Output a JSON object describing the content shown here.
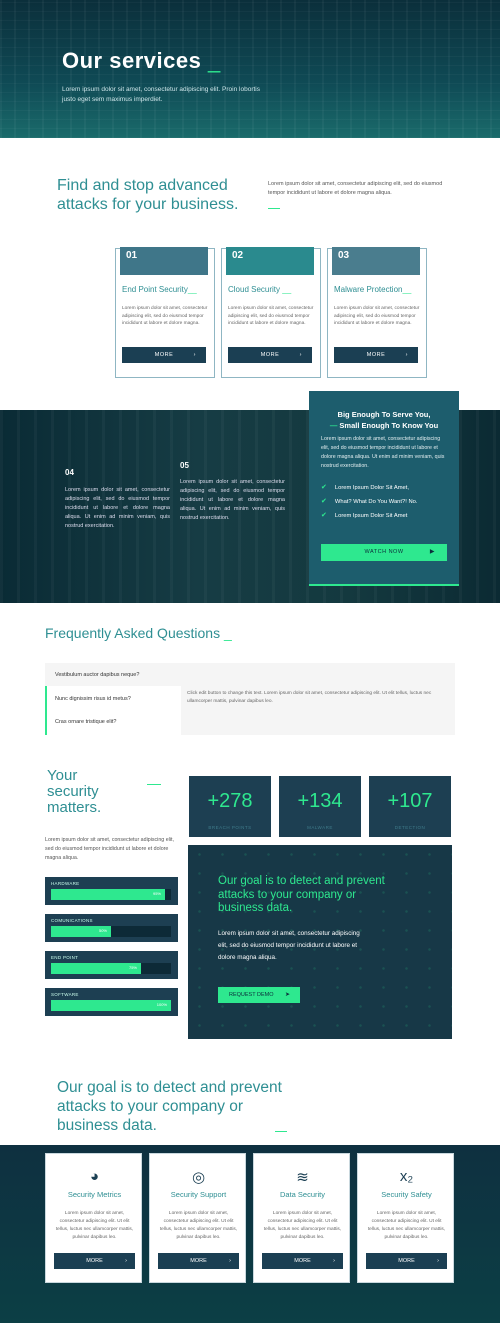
{
  "hero": {
    "title": "Our services",
    "title_underscore": "_",
    "subtitle": "Lorem ipsum dolor sit amet, consectetur adipiscing elit. Proin lobortis justo eget sem maximus imperdiet."
  },
  "intro": {
    "title": "Find and stop advanced attacks for your business.",
    "text": "Lorem ipsum dolor sit amet, consectetur adipiscing elit, sed do eiusmod tempor incididunt ut labore et dolore magna aliqua."
  },
  "services": [
    {
      "num": "01",
      "title": "End Point Security",
      "text": "Lorem ipsum dolor sit amet, consectetur adipiscing elit, sed do eiusmod tempor incididunt ut labore et dolore magna.",
      "button": "MORE"
    },
    {
      "num": "02",
      "title": "Cloud Security",
      "text": "Lorem ipsum dolor sit amet, consectetur adipiscing elit, sed do eiusmod tempor incididunt ut labore et dolore magna.",
      "button": "MORE"
    },
    {
      "num": "03",
      "title": "Malware Protection",
      "text": "Lorem ipsum dolor sit amet, consectetur adipiscing elit, sed do eiusmod tempor incididunt ut labore et dolore magna.",
      "button": "MORE"
    }
  ],
  "band": {
    "features": [
      {
        "num": "04",
        "text": "Lorem ipsum dolor sit amet, consectetur adipiscing elit, sed do eiusmod tempor incididunt ut labore et dolore magna aliqua. Ut enim ad minim veniam, quis nostrud exercitation."
      },
      {
        "num": "05",
        "text": "Lorem ipsum dolor sit amet, consectetur adipiscing elit, sed do eiusmod tempor incididunt ut labore et dolore magna aliqua. Ut enim ad minim veniam, quis nostrud exercitation."
      }
    ],
    "card": {
      "title_line1": "Big Enough To Serve You,",
      "title_line2": "Small Enough To Know You",
      "text": "Lorem ipsum dolor sit amet, consectetur adipiscing elit, sed do eiusmod tempor incididunt ut labore et dolore magna aliqua. Ut enim ad minim veniam, quis nostrud exercitation.",
      "checks": [
        "Lorem Ipsum Dolor Sit Amet,",
        "What? What Do You Want?! No.",
        "Lorem Ipsum Dolor Sit Amet"
      ],
      "button": "WATCH NOW"
    }
  },
  "faq": {
    "title": "Frequently Asked Questions",
    "questions": [
      "Vestibulum auctor dapibus neque?",
      "Nunc dignissim risus id metus?",
      "Cras ornare tristique elit?"
    ],
    "answer": "Click edit button to change this text. Lorem ipsum dolor sit amet, consectetur adipiscing elit. Ut elit tellus, luctus nec ullamcorper mattis, pulvinar dapibus leo."
  },
  "security": {
    "title_line1": "Your",
    "title_line2": "security",
    "title_line3": "matters.",
    "text": "Lorem ipsum dolor sit amet, consectetur adipiscing elit, sed do eiusmod tempor incididunt ut labore et dolore magna aliqua.",
    "bars": [
      {
        "label": "HARDWARE",
        "pct": "95%",
        "value": 0.95
      },
      {
        "label": "COMUNICATIONS",
        "pct": "50%",
        "value": 0.5
      },
      {
        "label": "END POINT",
        "pct": "75%",
        "value": 0.75
      },
      {
        "label": "SOFTWARE",
        "pct": "100%",
        "value": 1.0
      }
    ],
    "stats": [
      {
        "value": "+278",
        "caption": "BREACH POINTS"
      },
      {
        "value": "+134",
        "caption": "MALWARE"
      },
      {
        "value": "+107",
        "caption": "DETECTION"
      }
    ],
    "goal": {
      "title": "Our goal is to detect and prevent attacks to your company or business data.",
      "text": "Lorem ipsum dolor sit amet, consectetur adipiscing elit, sed do eiusmod tempor incididunt ut labore et dolore magna aliqua.",
      "button": "REQUEST DEMO"
    }
  },
  "bottom": {
    "title": "Our goal is to detect and prevent attacks to your company or business data.",
    "features": [
      {
        "icon": "dashboard-icon",
        "glyph": "◕",
        "title": "Security Metrics",
        "text": "Lorem ipsum dolor sit amet, consectetur adipiscing elit. Ut elit tellus, luctus nec ullamcorper mattis, pulvinar dapibus leo.",
        "button": "MORE"
      },
      {
        "icon": "lifebuoy-icon",
        "glyph": "◎",
        "title": "Security Support",
        "text": "Lorem ipsum dolor sit amet, consectetur adipiscing elit. Ut elit tellus, luctus nec ullamcorper mattis, pulvinar dapibus leo.",
        "button": "MORE"
      },
      {
        "icon": "stack-icon",
        "glyph": "≋",
        "title": "Data Security",
        "text": "Lorem ipsum dolor sit amet, consectetur adipiscing elit. Ut elit tellus, luctus nec ullamcorper mattis, pulvinar dapibus leo.",
        "button": "MORE"
      },
      {
        "icon": "subscript-icon",
        "glyph": "x₂",
        "title": "Security Safety",
        "text": "Lorem ipsum dolor sit amet, consectetur adipiscing elit. Ut elit tellus, luctus nec ullamcorper mattis, pulvinar dapibus leo.",
        "button": "MORE"
      }
    ]
  },
  "colors": {
    "accent": "#2ee88f",
    "teal": "#2f8f93",
    "navy": "#1b3f53"
  }
}
